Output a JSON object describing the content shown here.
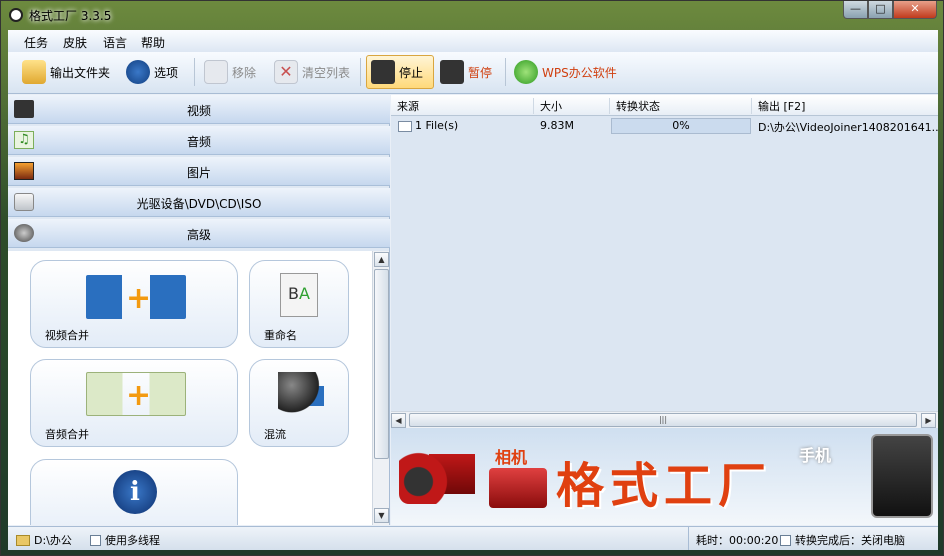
{
  "window": {
    "title": "格式工厂  3.3.5"
  },
  "menu": [
    "任务",
    "皮肤",
    "语言",
    "帮助"
  ],
  "toolbar": {
    "output_folder": "输出文件夹",
    "options": "选项",
    "remove": "移除",
    "clear_list": "清空列表",
    "stop": "停止",
    "pause": "暂停",
    "wps": "WPS办公软件"
  },
  "categories": [
    "视频",
    "音频",
    "图片",
    "光驱设备\\DVD\\CD\\ISO",
    "高级"
  ],
  "tools": [
    "视频合并",
    "重命名",
    "音频合并",
    "混流"
  ],
  "table": {
    "headers": [
      "来源",
      "大小",
      "转换状态",
      "输出 [F2]"
    ],
    "rows": [
      {
        "source": "1 File(s)",
        "size": "9.83M",
        "status": "0%",
        "output": "D:\\办公\\VideoJoiner1408201641..."
      }
    ]
  },
  "banner": {
    "title": "格式工厂",
    "camera": "相机",
    "phone": "手机"
  },
  "status": {
    "path": "D:\\办公",
    "multithread": "使用多线程",
    "elapsed": "耗时：00:00:20",
    "after": "转换完成后：关闭电脑"
  },
  "colors": {
    "accent": "#e04010",
    "panel": "#dfe8f3"
  }
}
